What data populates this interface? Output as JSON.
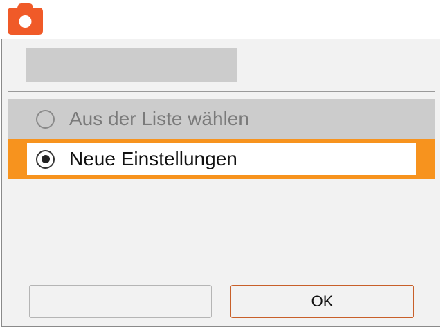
{
  "app": {
    "icon": "camera-icon",
    "accent_color": "#f05a28"
  },
  "dialog": {
    "title": "",
    "options": [
      {
        "label": "Aus der Liste wählen",
        "state": "unselected",
        "enabled": false
      },
      {
        "label": "Neue Einstellungen",
        "state": "selected",
        "enabled": true
      }
    ],
    "highlight_color": "#f7931e",
    "buttons": {
      "left_label": "",
      "right_label": "OK"
    }
  }
}
